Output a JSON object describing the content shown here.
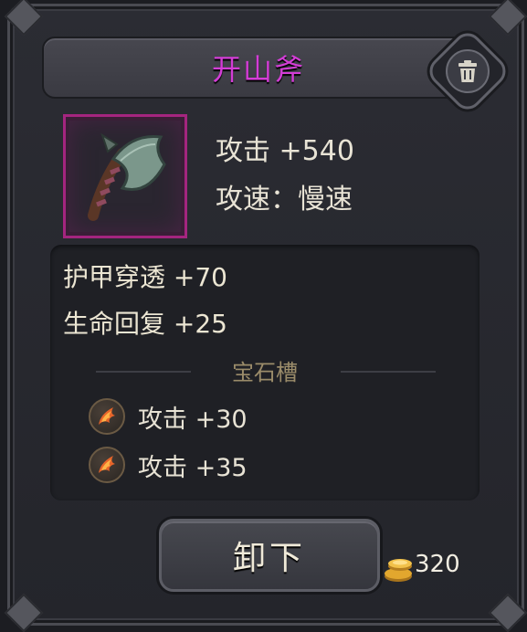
{
  "item": {
    "name": "开山斧",
    "rarity_color": "#d33dd6"
  },
  "main_stats": [
    {
      "text": "攻击 +540"
    },
    {
      "text": "攻速：慢速"
    }
  ],
  "bonus_stats": [
    {
      "text": "护甲穿透 +70"
    },
    {
      "text": "生命回复 +25"
    }
  ],
  "gem_slots": {
    "title": "宝石槽",
    "items": [
      {
        "icon": "fire-gem-icon",
        "text": "攻击 +30"
      },
      {
        "icon": "fire-gem-icon",
        "text": "攻击 +35"
      }
    ]
  },
  "actions": {
    "unequip_label": "卸下",
    "delete_icon": "trash-icon"
  },
  "currency": {
    "icon": "gold-coin-icon",
    "value": "320"
  }
}
